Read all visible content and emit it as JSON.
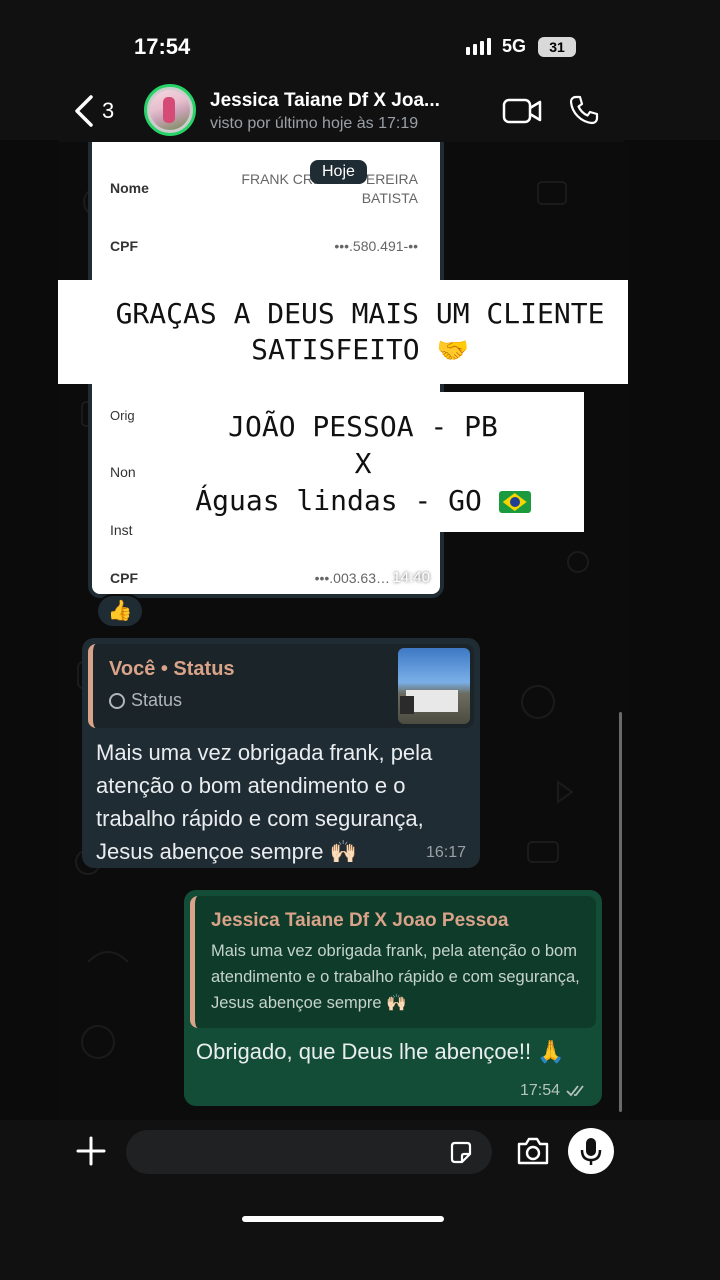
{
  "status_bar": {
    "time": "17:54",
    "network": "5G",
    "battery": "31"
  },
  "header": {
    "back_count": "3",
    "contact_name": "Jessica Taiane Df X Joa...",
    "last_seen": "visto por último hoje às 17:19"
  },
  "chat": {
    "date_label": "Hoje",
    "document": {
      "rows": [
        {
          "label": "Nome",
          "value": "FRANK CRISTI… PEREIRA BATISTA"
        },
        {
          "label": "CPF",
          "value": "•••.580.491-••"
        },
        {
          "label": "Orig",
          "value": ""
        },
        {
          "label": "Non",
          "value": ""
        },
        {
          "label": "Inst",
          "value": ""
        },
        {
          "label": "CPF",
          "value": "•••.003.63…"
        }
      ],
      "time": "14:40"
    },
    "caption_line1": "GRAÇAS A DEUS MAIS UM CLIENTE",
    "caption_line2": "SATISFEITO",
    "caption_route_from": "JOÃO PESSOA - PB",
    "caption_route_x": "X",
    "caption_route_to": "Águas lindas - GO",
    "reaction": "👍",
    "incoming": {
      "quote_title": "Você • Status",
      "quote_subtitle": "Status",
      "text": "Mais uma vez obrigada frank, pela atenção o bom atendimento e o trabalho rápido e com segurança, Jesus abençoe sempre 🙌🏻",
      "time": "16:17"
    },
    "outgoing": {
      "quote_title": "Jessica Taiane Df X Joao Pessoa",
      "quote_text": "Mais uma vez obrigada frank, pela atenção o bom atendimento e o trabalho rápido e com segurança, Jesus abençoe sempre 🙌🏻",
      "text": "Obrigado, que Deus lhe abençoe!! 🙏",
      "time": "17:54"
    }
  },
  "colors": {
    "accent": "#25d366",
    "quote_bar": "#d9a389",
    "outgoing_bubble": "#144d37",
    "incoming_bubble": "#202c33"
  },
  "icons": [
    "chevron-left-icon",
    "video-call-icon",
    "phone-icon",
    "plus-icon",
    "sticker-icon",
    "camera-icon",
    "mic-icon",
    "double-check-icon"
  ]
}
